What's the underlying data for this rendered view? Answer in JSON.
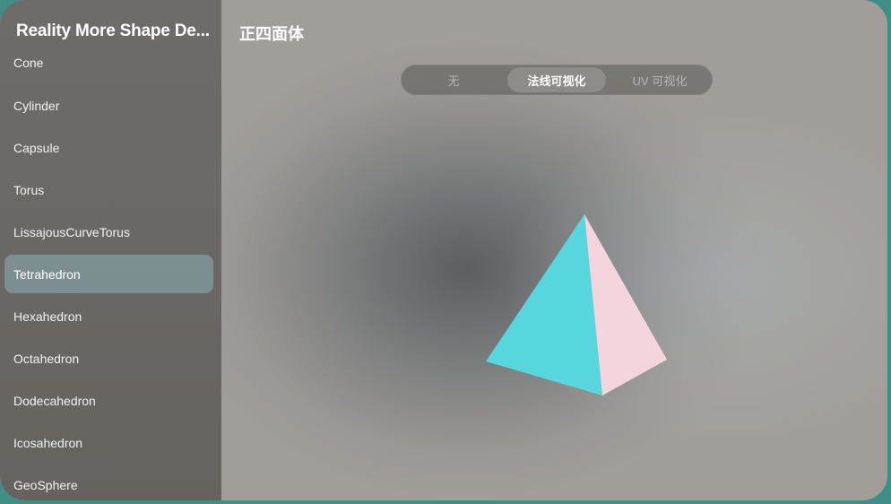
{
  "sidebar": {
    "title": "Reality More Shape De...",
    "items": [
      {
        "label": "Cone"
      },
      {
        "label": "Cylinder"
      },
      {
        "label": "Capsule"
      },
      {
        "label": "Torus"
      },
      {
        "label": "LissajousCurveTorus"
      },
      {
        "label": "Tetrahedron",
        "selected": true
      },
      {
        "label": "Hexahedron"
      },
      {
        "label": "Octahedron"
      },
      {
        "label": "Dodecahedron"
      },
      {
        "label": "Icosahedron"
      },
      {
        "label": "GeoSphere"
      }
    ]
  },
  "main": {
    "title": "正四面体",
    "segments": [
      {
        "label": "无"
      },
      {
        "label": "法线可视化",
        "selected": true
      },
      {
        "label": "UV 可视化"
      }
    ]
  },
  "colors": {
    "face_left": "#58d6de",
    "face_right": "#f4d5de",
    "selection": "#8cafb4"
  }
}
